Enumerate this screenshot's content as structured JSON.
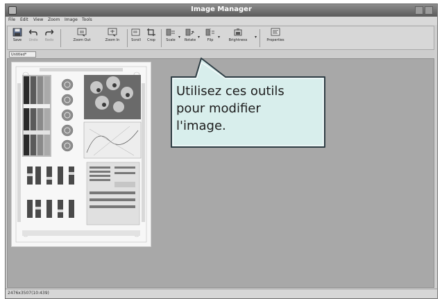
{
  "window": {
    "title": "Image Manager"
  },
  "menu": [
    "File",
    "Edit",
    "View",
    "Zoom",
    "Image",
    "Tools"
  ],
  "toolbar": {
    "tools": [
      {
        "id": "save",
        "label": "Save",
        "icon": "floppy-icon",
        "enabled": true
      },
      {
        "id": "undo",
        "label": "Undo",
        "icon": "undo-icon",
        "enabled": false
      },
      {
        "id": "redo",
        "label": "Redo",
        "icon": "redo-icon",
        "enabled": false
      },
      {
        "id": "zoom-out",
        "label": "Zoom Out",
        "icon": "zoom-out-icon",
        "enabled": true
      },
      {
        "id": "zoom-in",
        "label": "Zoom In",
        "icon": "zoom-in-icon",
        "enabled": true
      },
      {
        "id": "scroll",
        "label": "Scroll",
        "icon": "scroll-icon",
        "enabled": true
      },
      {
        "id": "crop",
        "label": "Crop",
        "icon": "crop-icon",
        "enabled": true
      },
      {
        "id": "scale",
        "label": "Scale",
        "icon": "scale-icon",
        "enabled": true
      },
      {
        "id": "rotate",
        "label": "Rotate",
        "icon": "rotate-icon",
        "enabled": true
      },
      {
        "id": "flip",
        "label": "Flip",
        "icon": "flip-icon",
        "enabled": true
      },
      {
        "id": "brightness",
        "label": "Brightness",
        "icon": "brightness-icon",
        "enabled": true
      },
      {
        "id": "properties",
        "label": "Properties",
        "icon": "properties-icon",
        "enabled": true
      }
    ]
  },
  "document_tab": {
    "label": "Untitled*"
  },
  "status": {
    "coords": "2476x3507(10:439)"
  },
  "callout": {
    "line1": "Utilisez ces outils",
    "line2": "pour modifier",
    "line3": "l'image."
  },
  "colors": {
    "callout_fill": "#d8eeec",
    "callout_border": "#2e3d44",
    "canvas": "#a8a8a8",
    "titlebar": "#6f6f6f"
  }
}
